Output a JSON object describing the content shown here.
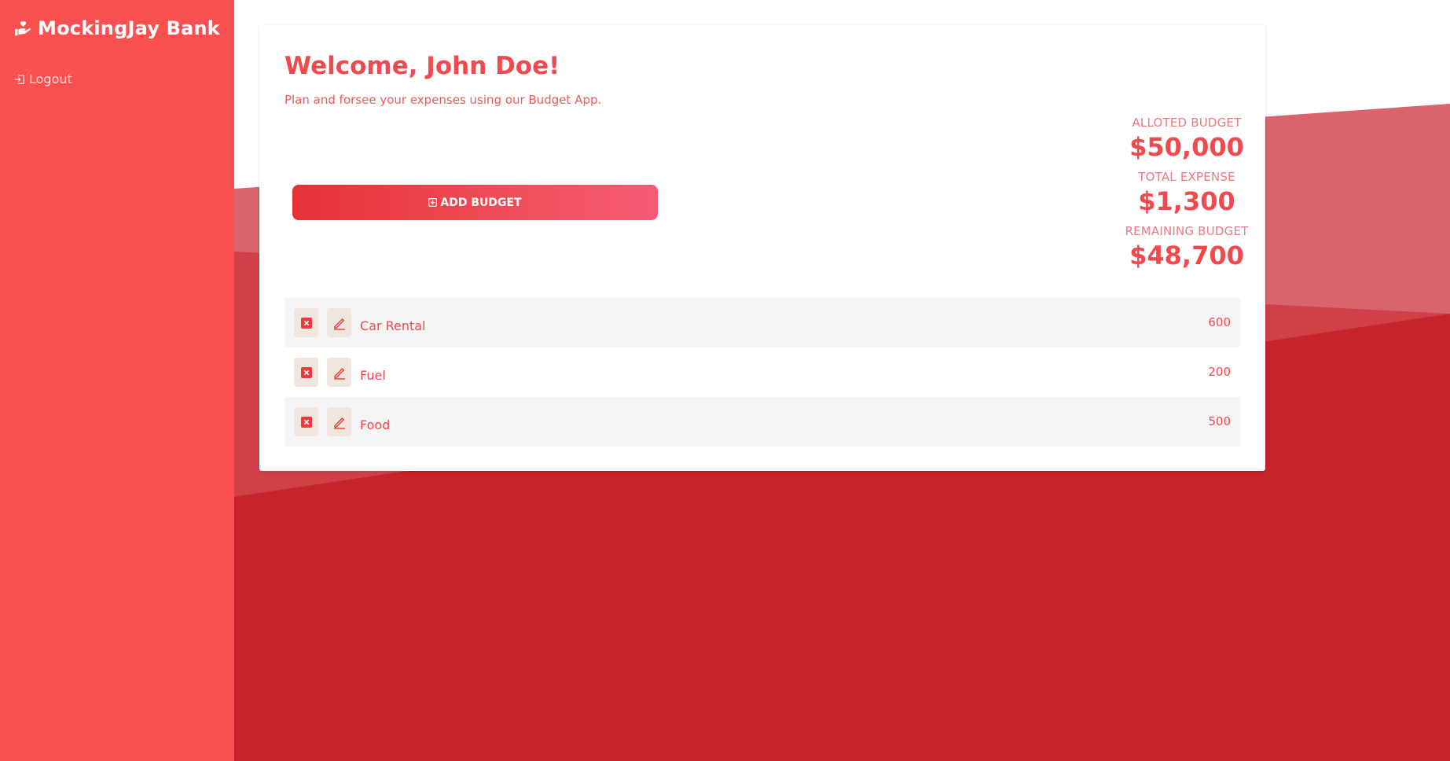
{
  "brand": {
    "name": "MockingJay Bank",
    "icon": "hand-heart-icon"
  },
  "sidebar": {
    "logout_label": "Logout",
    "logout_icon": "logout-icon"
  },
  "header": {
    "welcome": "Welcome, John Doe!",
    "subtitle": "Plan and forsee your expenses using our Budget App."
  },
  "actions": {
    "add_budget_label": "ADD BUDGET"
  },
  "stats": {
    "alloted_label": "ALLOTED BUDGET",
    "alloted_value": "$50,000",
    "expense_label": "TOTAL EXPENSE",
    "expense_value": "$1,300",
    "remaining_label": "REMAINING BUDGET",
    "remaining_value": "$48,700"
  },
  "expenses": [
    {
      "name": "Car Rental",
      "amount": "600"
    },
    {
      "name": "Fuel",
      "amount": "200"
    },
    {
      "name": "Food",
      "amount": "500"
    }
  ],
  "colors": {
    "sidebar": "#fa5050",
    "accent": "#f04a4f",
    "background_dark": "#c8222b",
    "background_light": "#d9646d",
    "icon_button_bg": "#efe7de"
  }
}
